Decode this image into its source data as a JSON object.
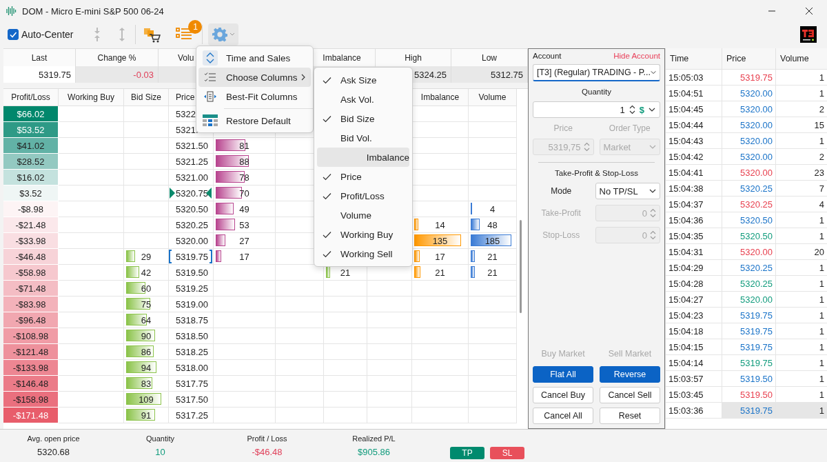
{
  "window": {
    "title": "DOM - Micro E-mini S&P 500 06-24"
  },
  "toolbar": {
    "auto_center": {
      "label": "Auto-Center",
      "checked": true
    },
    "badge": "1"
  },
  "stats": [
    {
      "label": "Last",
      "value": "5319.75",
      "color": "#222222"
    },
    {
      "label": "Change %",
      "value": "-0.03",
      "color": "#e0405a"
    },
    {
      "label": "Volu"
    },
    {
      "label": "Imbalance"
    },
    {
      "label": "High",
      "value": "5324.25",
      "color": "#222222"
    },
    {
      "label": "Low",
      "value": "5312.75",
      "color": "#222222"
    }
  ],
  "grid": {
    "columns_left": [
      "Profit/Loss",
      "Working Buy",
      "Bid Size",
      "Price"
    ],
    "columns_right": [
      "Imbalance",
      "Volume"
    ],
    "rows": [
      {
        "kind": "plain",
        "pl": "$66.02",
        "color": "#00876c",
        "price": "5322"
      },
      {
        "kind": "plain",
        "pl": "$53.52",
        "color": "#2e9a86",
        "price": "5321."
      },
      {
        "kind": "plain",
        "pl": "$41.02",
        "color": "#62b2a6",
        "price": "5321.50",
        "ask": {
          "value": "81",
          "level": 0.52
        }
      },
      {
        "kind": "plain",
        "pl": "$28.52",
        "color": "#93c9c1",
        "price": "5321.25",
        "ask": {
          "value": "88",
          "level": 0.58
        }
      },
      {
        "kind": "plain",
        "pl": "$16.02",
        "color": "#c4e2de",
        "price": "5321.00",
        "ask": {
          "value": "78",
          "level": 0.51
        }
      },
      {
        "kind": "last",
        "pl": "$3.52",
        "color": "#eff6f5",
        "price": "5320.75",
        "ask": {
          "value": "70",
          "level": 0.46
        }
      },
      {
        "kind": "plain",
        "pl": "-$8.98",
        "color": "#fdf4f5",
        "price": "5320.50",
        "ask": {
          "value": "49",
          "level": 0.31
        },
        "volume": {
          "value": "4",
          "level": 0.02
        }
      },
      {
        "kind": "plain",
        "pl": "-$21.48",
        "color": "#fbe8eb",
        "price": "5320.25",
        "ask": {
          "value": "53",
          "level": 0.34
        },
        "imbalance": {
          "value": "14",
          "level": 0.08
        },
        "volume": {
          "value": "48",
          "level": 0.21
        }
      },
      {
        "kind": "plain",
        "pl": "-$33.98",
        "color": "#f9dee2",
        "price": "5320.00",
        "ask": {
          "value": "27",
          "level": 0.17
        },
        "imbalance": {
          "value": "135",
          "level": 0.91
        },
        "volume": {
          "value": "185",
          "level": 0.93
        }
      },
      {
        "kind": "current",
        "pl": "-$46.48",
        "color": "#f7d3d8",
        "price": "5319.75",
        "bid": {
          "value": "29",
          "level": 0.23
        },
        "ask": {
          "value": "17",
          "level": 0.1
        },
        "imbalance": {
          "value": "17",
          "level": 0.1
        },
        "volume": {
          "value": "21",
          "level": 0.09
        }
      },
      {
        "kind": "plain",
        "pl": "-$58.98",
        "color": "#f6c8ce",
        "price": "5319.50",
        "bid": {
          "value": "42",
          "level": 0.33
        },
        "c7": {
          "value": "21",
          "level": 0.1
        },
        "imbalance": {
          "value": "21",
          "level": 0.12
        },
        "volume": {
          "value": "21",
          "level": 0.09
        }
      },
      {
        "kind": "plain",
        "pl": "-$71.48",
        "color": "#f4bdc4",
        "price": "5319.25",
        "bid": {
          "value": "60",
          "level": 0.48
        }
      },
      {
        "kind": "plain",
        "pl": "-$83.98",
        "color": "#f3b2ba",
        "price": "5319.00",
        "bid": {
          "value": "75",
          "level": 0.6
        }
      },
      {
        "kind": "plain",
        "pl": "-$96.48",
        "color": "#f1a7b0",
        "price": "5318.75",
        "bid": {
          "value": "64",
          "level": 0.52
        }
      },
      {
        "kind": "plain",
        "pl": "-$108.98",
        "color": "#f09ca6",
        "price": "5318.50",
        "bid": {
          "value": "90",
          "level": 0.72
        }
      },
      {
        "kind": "plain",
        "pl": "-$121.48",
        "color": "#ee919c",
        "price": "5318.25",
        "bid": {
          "value": "86",
          "level": 0.69
        }
      },
      {
        "kind": "plain",
        "pl": "-$133.98",
        "color": "#ed8692",
        "price": "5318.00",
        "bid": {
          "value": "94",
          "level": 0.75
        }
      },
      {
        "kind": "plain",
        "pl": "-$146.48",
        "color": "#eb7b88",
        "price": "5317.75",
        "bid": {
          "value": "83",
          "level": 0.66
        }
      },
      {
        "kind": "plain",
        "pl": "-$158.98",
        "color": "#ea707e",
        "price": "5317.50",
        "bid": {
          "value": "109",
          "level": 0.88
        }
      },
      {
        "kind": "plain",
        "pl": "-$171.48",
        "color": "#e85d6b",
        "price": "5317.25",
        "bid": {
          "value": "91",
          "level": 0.72
        }
      }
    ]
  },
  "menu": {
    "items": [
      {
        "label": "Time and Sales",
        "kind": "time-sales",
        "selected": false,
        "submenu": false,
        "separator_before": false
      },
      {
        "label": "Choose Columns",
        "kind": "columns",
        "selected": true,
        "submenu": true,
        "separator_before": false
      },
      {
        "label": "Best-Fit Columns",
        "kind": "fit",
        "selected": false,
        "submenu": false,
        "separator_before": false
      },
      {
        "label": "Restore Default",
        "kind": "restore",
        "selected": false,
        "submenu": false,
        "separator_before": true
      }
    ],
    "submenu": [
      {
        "label": "Ask Size",
        "checked": true,
        "selected": false
      },
      {
        "label": "Ask Vol.",
        "checked": false,
        "selected": false
      },
      {
        "label": "Bid Size",
        "checked": true,
        "selected": false
      },
      {
        "label": "Bid Vol.",
        "checked": false,
        "selected": false
      },
      {
        "label": "Imbalance",
        "checked": false,
        "selected": true
      },
      {
        "label": "Price",
        "checked": true,
        "selected": false
      },
      {
        "label": "Profit/Loss",
        "checked": true,
        "selected": false
      },
      {
        "label": "Volume",
        "checked": false,
        "selected": false
      },
      {
        "label": "Working Buy",
        "checked": true,
        "selected": false
      },
      {
        "label": "Working Sell",
        "checked": true,
        "selected": false
      }
    ]
  },
  "order_panel": {
    "account_label": "Account",
    "hide_account": "Hide Account",
    "account": "[T3] (Regular) TRADING - P...",
    "quantity_label": "Quantity",
    "quantity": "1",
    "currency": "$",
    "price": {
      "label": "Price",
      "value": "5319,75",
      "disabled": true
    },
    "order_type": {
      "label": "Order Type",
      "value": "Market",
      "disabled": true
    },
    "tpsl_title": "Take-Profit & Stop-Loss",
    "mode": {
      "label": "Mode",
      "value": "No TP/SL",
      "disabled": false
    },
    "take_profit": {
      "label": "Take-Profit",
      "value": "0",
      "disabled": true
    },
    "stop_loss": {
      "label": "Stop-Loss",
      "value": "0",
      "disabled": true
    },
    "buttons": [
      {
        "label": "Buy Market",
        "disabled": true,
        "primary": false
      },
      {
        "label": "Sell Market",
        "disabled": true,
        "primary": false
      },
      {
        "label": "Flat All",
        "disabled": false,
        "primary": true
      },
      {
        "label": "Reverse",
        "disabled": false,
        "primary": true
      },
      {
        "label": "Cancel Buy",
        "disabled": false,
        "primary": false
      },
      {
        "label": "Cancel Sell",
        "disabled": false,
        "primary": false
      },
      {
        "label": "Cancel All",
        "disabled": false,
        "primary": false
      },
      {
        "label": "Reset",
        "disabled": false,
        "primary": false
      }
    ]
  },
  "time_sales": {
    "columns": [
      "Time",
      "Price",
      "Volume"
    ],
    "rows": [
      {
        "time": "15:05:03",
        "price": "5319.75",
        "volume": "1",
        "color": "#e8404f",
        "selected": false
      },
      {
        "time": "15:04:51",
        "price": "5320.00",
        "volume": "1",
        "color": "#1a73c8",
        "selected": false
      },
      {
        "time": "15:04:45",
        "price": "5320.00",
        "volume": "2",
        "color": "#1a73c8",
        "selected": false
      },
      {
        "time": "15:04:44",
        "price": "5320.00",
        "volume": "15",
        "color": "#1a73c8",
        "selected": false
      },
      {
        "time": "15:04:43",
        "price": "5320.00",
        "volume": "1",
        "color": "#1a73c8",
        "selected": false
      },
      {
        "time": "15:04:42",
        "price": "5320.00",
        "volume": "2",
        "color": "#1a73c8",
        "selected": false
      },
      {
        "time": "15:04:41",
        "price": "5320.00",
        "volume": "23",
        "color": "#e8404f",
        "selected": false
      },
      {
        "time": "15:04:38",
        "price": "5320.25",
        "volume": "7",
        "color": "#1a73c8",
        "selected": false
      },
      {
        "time": "15:04:37",
        "price": "5320.25",
        "volume": "4",
        "color": "#e8404f",
        "selected": false
      },
      {
        "time": "15:04:36",
        "price": "5320.50",
        "volume": "1",
        "color": "#1a73c8",
        "selected": false
      },
      {
        "time": "15:04:35",
        "price": "5320.50",
        "volume": "1",
        "color": "#109b7c",
        "selected": false
      },
      {
        "time": "15:04:31",
        "price": "5320.00",
        "volume": "20",
        "color": "#e8404f",
        "selected": false
      },
      {
        "time": "15:04:29",
        "price": "5320.25",
        "volume": "1",
        "color": "#1a73c8",
        "selected": false
      },
      {
        "time": "15:04:28",
        "price": "5320.25",
        "volume": "1",
        "color": "#109b7c",
        "selected": false
      },
      {
        "time": "15:04:27",
        "price": "5320.00",
        "volume": "1",
        "color": "#109b7c",
        "selected": false
      },
      {
        "time": "15:04:23",
        "price": "5319.75",
        "volume": "1",
        "color": "#1a73c8",
        "selected": false
      },
      {
        "time": "15:04:18",
        "price": "5319.75",
        "volume": "1",
        "color": "#1a73c8",
        "selected": false
      },
      {
        "time": "15:04:15",
        "price": "5319.75",
        "volume": "1",
        "color": "#1a73c8",
        "selected": false
      },
      {
        "time": "15:04:14",
        "price": "5319.75",
        "volume": "1",
        "color": "#109b7c",
        "selected": false
      },
      {
        "time": "15:03:57",
        "price": "5319.50",
        "volume": "1",
        "color": "#1a73c8",
        "selected": false
      },
      {
        "time": "15:03:45",
        "price": "5319.50",
        "volume": "1",
        "color": "#e8404f",
        "selected": false
      },
      {
        "time": "15:03:36",
        "price": "5319.75",
        "volume": "1",
        "color": "#1a73c8",
        "selected": true
      }
    ]
  },
  "summary": [
    {
      "label": "Avg. open price",
      "value": "5320.68",
      "color": "#222222"
    },
    {
      "label": "Quantity",
      "value": "10",
      "color": "#109b7c"
    },
    {
      "label": "Profit / Loss",
      "value": "-$46.48",
      "color": "#e0405a"
    },
    {
      "label": "Realized P/L",
      "value": "$905.86",
      "color": "#109b7c"
    }
  ],
  "tp_sl": [
    {
      "label": "TP",
      "color": "#008a6e"
    },
    {
      "label": "SL",
      "color": "#e8505b"
    }
  ]
}
